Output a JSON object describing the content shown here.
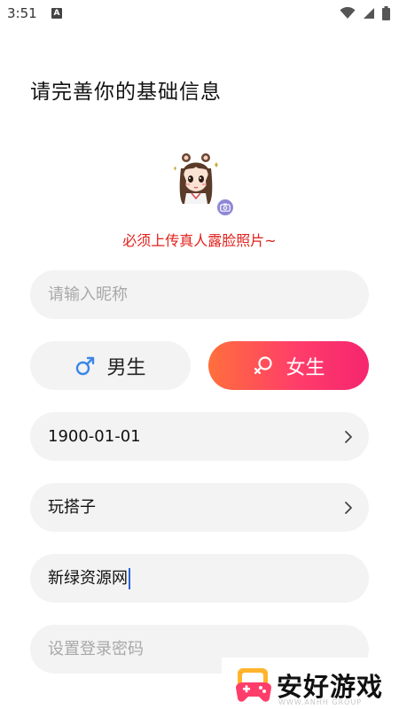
{
  "status_bar": {
    "time": "3:51",
    "notification_letter": "A"
  },
  "page": {
    "title": "请完善你的基础信息"
  },
  "avatar": {
    "hint": "必须上传真人露脸照片~",
    "camera_icon": "camera-icon"
  },
  "form": {
    "nickname": {
      "placeholder": "请输入昵称",
      "value": ""
    },
    "gender": {
      "male_label": "男生",
      "female_label": "女生",
      "selected": "female",
      "selected_color": "#ff4d5f"
    },
    "birthday": {
      "value": "1900-01-01"
    },
    "hobby": {
      "value": "玩搭子"
    },
    "signature": {
      "value": "新绿资源网"
    },
    "password": {
      "placeholder": "设置登录密码",
      "value": ""
    }
  },
  "watermark": {
    "title": "安好游戏",
    "subtitle": "WWW.ANHH GROUP"
  }
}
